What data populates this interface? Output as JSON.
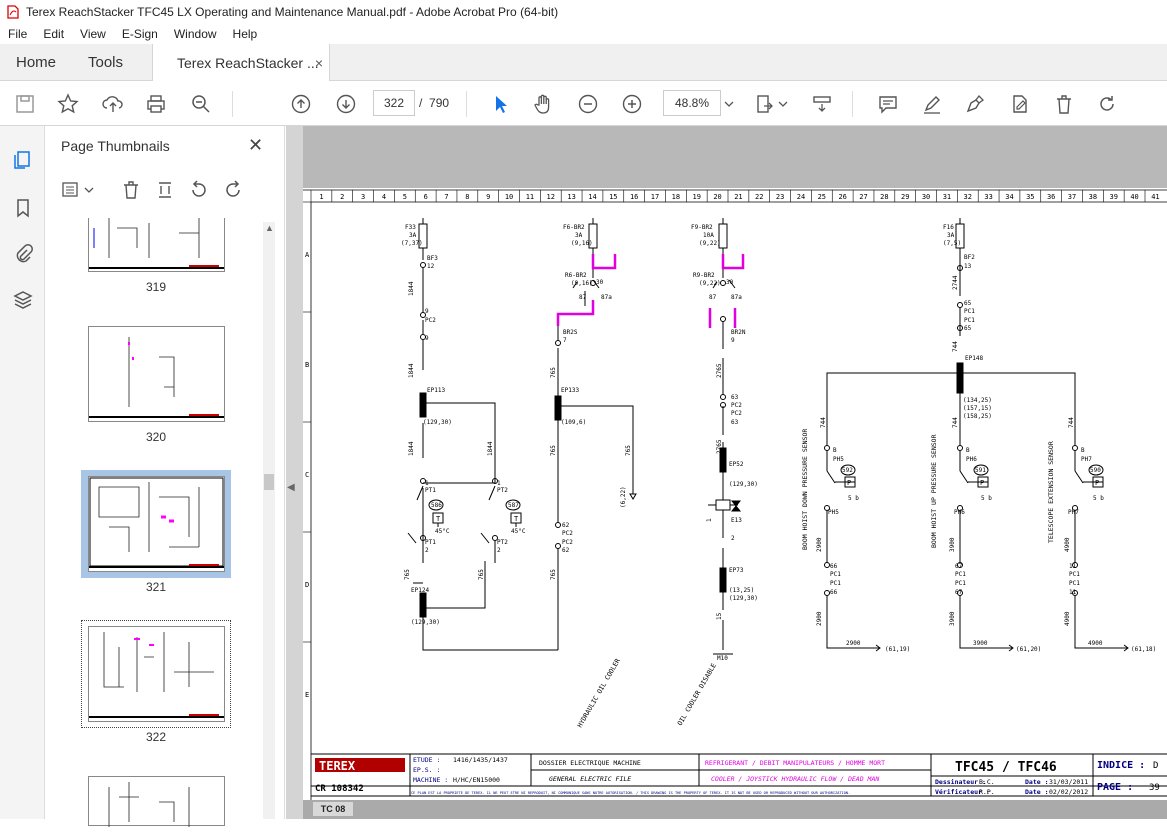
{
  "window": {
    "title": "Terex ReachStacker TFC45 LX Operating and Maintenance Manual.pdf - Adobe Acrobat Pro (64-bit)"
  },
  "menu": [
    "File",
    "Edit",
    "View",
    "E-Sign",
    "Window",
    "Help"
  ],
  "tabs": {
    "home": "Home",
    "tools": "Tools",
    "doc": "Terex ReachStacker ...",
    "close": "×"
  },
  "toolbar": {
    "page_current": "322",
    "page_sep": "/",
    "page_total": "790",
    "zoom": "48.8%"
  },
  "panel": {
    "title": "Page Thumbnails",
    "close": "✕"
  },
  "thumbnails": [
    {
      "num": "319"
    },
    {
      "num": "320"
    },
    {
      "num": "321"
    },
    {
      "num": "322"
    }
  ],
  "doc": {
    "cols": [
      "1",
      "2",
      "3",
      "4",
      "5",
      "6",
      "7",
      "8",
      "9",
      "10",
      "11",
      "12",
      "13",
      "14",
      "15",
      "16",
      "17",
      "18",
      "19",
      "20",
      "21",
      "22",
      "23",
      "24",
      "25",
      "26",
      "27",
      "28",
      "29",
      "30",
      "31",
      "32",
      "33",
      "34",
      "35",
      "36",
      "37",
      "38",
      "39",
      "40",
      "41"
    ],
    "rows": [
      "A",
      "B",
      "C",
      "D",
      "E"
    ],
    "labels": {
      "f33": "F33",
      "f33a": "3A",
      "f33r": "(7,37)",
      "bf3": "BF3",
      "bf3n": "12",
      "w1844a": "1844",
      "pc2a": "9",
      "pc2l": "PC2",
      "pc2b": "9",
      "w1844b": "1844",
      "ep113": "EP113",
      "ep113r": "(129,30)",
      "w1844c": "1844",
      "w1844d": "1844",
      "pt1a": "1",
      "pt1l": "PT1",
      "pt2a": "1",
      "pt2l": "PT2",
      "c586": "586",
      "c587": "587",
      "deg1": "45°C",
      "deg2": "45°C",
      "pt1b": "PT1",
      "pt1c": "2",
      "pt2b": "PT2",
      "pt2c": "2",
      "w765a": "765",
      "w765b": "765",
      "ep124": "EP124",
      "ep124r": "(129,30)",
      "f6": "F6-BR2",
      "f6a": "3A",
      "f6r": "(9,16)",
      "r6": "R6-BR2",
      "r6r": "(9,16)",
      "r6n": "30",
      "r687": "87",
      "r687a": "87a",
      "br2s": "BR2S",
      "br2sn": "7",
      "w765c": "765",
      "ep133": "EP133",
      "ep133r": "(109,6)",
      "w765d": "765",
      "w765e": "765",
      "w765f": "765",
      "c6221": "(6,22)",
      "p62a": "62",
      "p62l": "PC2",
      "p62b": "PC2",
      "p62c": "62",
      "f9": "F9-BR2",
      "f9a": "10A",
      "f9r": "(9,22)",
      "r9": "R9-BR2",
      "r9r": "(9,22)",
      "r9n": "30",
      "r987": "87",
      "r987a": "87a",
      "br2n": "BR2N",
      "br2nn": "9",
      "w2765a": "2765",
      "p63a": "63",
      "p63l": "PC2",
      "p63b": "PC2",
      "p63c": "63",
      "w2765b": "2765",
      "ep52": "EP52",
      "ep52r": "(129,30)",
      "e13": "E13",
      "e13a": "1",
      "e13b": "2",
      "ep73": "EP73",
      "ep73r": "(13,25)",
      "ep73r2": "(129,30)",
      "w15": "15",
      "m10": "M10",
      "fx": "F16",
      "fxa": "3A",
      "fxr": "(7,5)",
      "bf2": "BF2",
      "bf2n": "13",
      "w2744": "2744",
      "p65a": "65",
      "p65l": "PC1",
      "p65b": "PC1",
      "p65c": "65",
      "w744a": "744",
      "ep148": "EP148",
      "ep148r": "(134,25)",
      "ep148r2": "(157,15)",
      "ep148r3": "(158,25)",
      "w744b": "744",
      "w744c": "744",
      "w744d": "744",
      "ph5a": "B",
      "ph5": "PH5",
      "c592": "592",
      "p5b": "5 b",
      "ph5b": "PH5",
      "w2900a": "2900",
      "p66a": "66",
      "p66l": "PC1",
      "p66b": "PC1",
      "p66c": "66",
      "w2900b": "2900",
      "w2900c": "2900",
      "r2900": "(61,19)",
      "ph6a": "B",
      "ph6": "PH6",
      "c591": "591",
      "p6b": "5 b",
      "ph6b": "PH6",
      "w3900a": "3900",
      "p67a": "67",
      "p67l": "PC1",
      "p67b": "PC1",
      "p67c": "67",
      "w3900b": "3900",
      "w3900c": "3900",
      "r3900": "(61,20)",
      "ph7a": "B",
      "ph7": "PH7",
      "c590": "590",
      "p7b": "5 b",
      "ph7b": "PH7",
      "w4900a": "4900",
      "p11a": "11",
      "p11l": "PC1",
      "p11b": "PC1",
      "p11c": "11",
      "w4900b": "4900",
      "w4900c": "4900",
      "r4900": "(61,18)",
      "v1": "BOOM HOIST DOWN PRESSURE SENSOR",
      "v2": "BOOM HOIST UP PRESSURE SENSOR",
      "v3": "TELESCOPE EXTENSION SENSOR",
      "v4": "HYDRAULIC OIL COOLER",
      "v5": "OIL COOLER DISABLE",
      "t_letter": "T",
      "p_letter": "P"
    },
    "titleblock": {
      "logo": "TEREX",
      "cr": "CR 108342",
      "etude_l": "ETUDE :",
      "etude_v": "1416/1435/1437",
      "eps_l": "EP.S. :",
      "machine_l": "MACHINE :",
      "machine_v": "H/HC/EN15000",
      "dossier": "DOSSIER ELECTRIQUE MACHINE",
      "general": "GENERAL ELECTRIC FILE",
      "fr": "REFRIGERANT / DEBIT MANIPULATEURS / HOMME MORT",
      "en": "COOLER / JOYSTICK HYDRAULIC FLOW / DEAD MAN",
      "model": "TFC45 / TFC46",
      "indice_l": "INDICE :",
      "indice_v": "D",
      "page_l": "PAGE :",
      "page_v": "39",
      "dess_l": "Dessinateur :",
      "dess_v": "B.C.",
      "date_l": "Date :",
      "date1": "31/03/2011",
      "verif_l": "Vérificateur :",
      "verif_v": "R.P.",
      "date2": "02/02/2012",
      "notice": "CE PLAN EST LA PROPRIETE DE TEREX. IL NE PEUT ETRE NI REPRODUIT, NI COMMUNIQUE SANS NOTRE AUTORISATION. / THIS DRAWING IS THE PROPERTY OF TEREX. IT IS NOT BE USED OR REPRODUCED WITHOUT OUR AUTHORIZATION.",
      "tc": "TC 08"
    }
  }
}
